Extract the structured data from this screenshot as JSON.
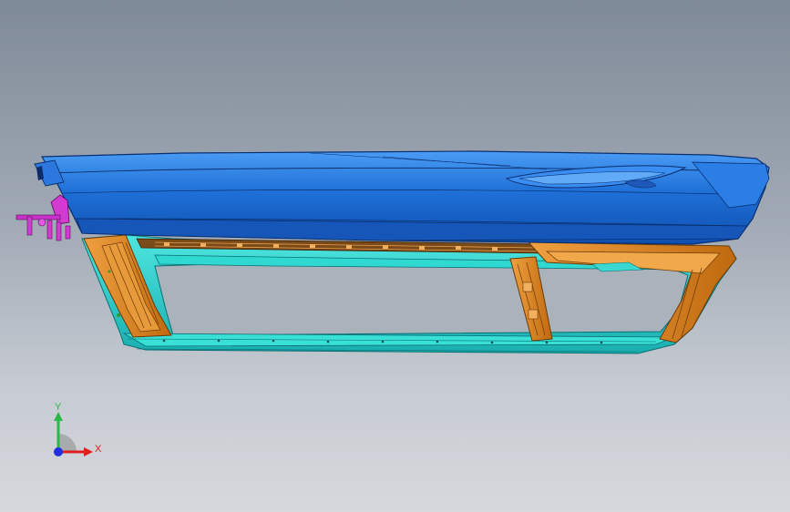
{
  "scene": {
    "model_colors": {
      "panel_blue": "#1e6fd6",
      "panel_blue_light": "#3a8cf0",
      "frame_cyan": "#26d0cc",
      "bracket_orange": "#e08a24",
      "clip_magenta": "#d23ad2",
      "background_top": "#7f8a98",
      "background_bottom": "#d6d8dc"
    }
  },
  "triad": {
    "y_label": "Y",
    "x_label": "X",
    "y_color": "#2ab84a",
    "x_color": "#e02020",
    "z_color": "#2030e0"
  }
}
